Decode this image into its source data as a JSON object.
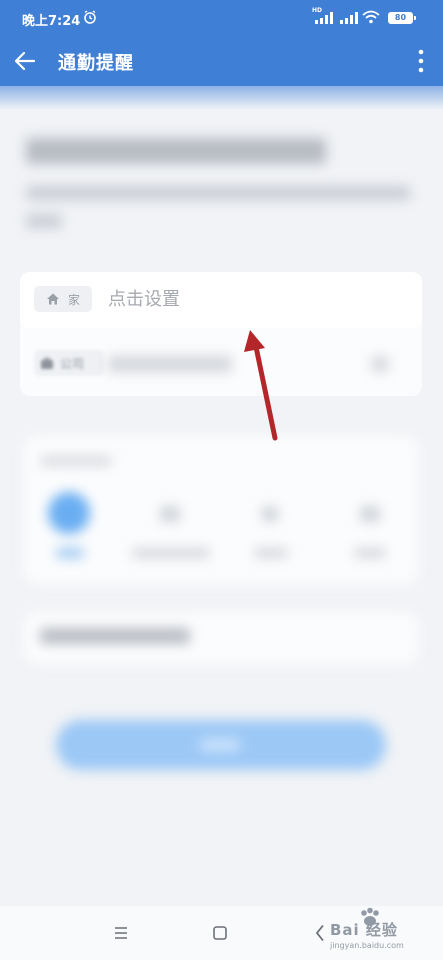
{
  "status_bar": {
    "time": "晚上7:24",
    "network_label": "HD",
    "battery": "80"
  },
  "app_bar": {
    "title": "通勤提醒"
  },
  "address_card": {
    "home": {
      "tag_label": "家",
      "placeholder": "点击设置"
    },
    "company": {
      "tag_label": "公司"
    }
  },
  "watermark": {
    "brand": "Bai 经验",
    "url": "jingyan.baidu.com"
  },
  "colors": {
    "primary": "#3f7fd5",
    "annotation_arrow": "#b3262a",
    "placeholder": "#a5a9b0"
  }
}
